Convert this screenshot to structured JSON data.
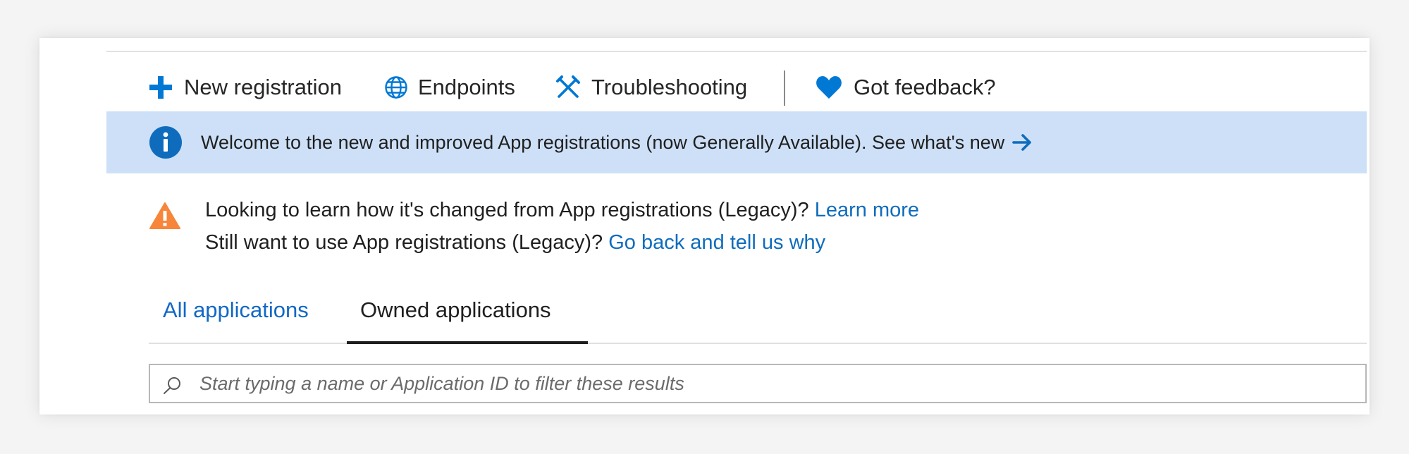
{
  "colors": {
    "accent": "#0078d4",
    "link": "#0f6cbd",
    "info_banner_bg": "#cde0f7",
    "warning": "#f7863a",
    "heart": "#0078d4"
  },
  "toolbar": {
    "items": [
      {
        "label": "New registration",
        "icon": "plus-icon"
      },
      {
        "label": "Endpoints",
        "icon": "globe-icon"
      },
      {
        "label": "Troubleshooting",
        "icon": "tools-icon"
      },
      {
        "label": "Got feedback?",
        "icon": "heart-icon"
      }
    ]
  },
  "info_banner": {
    "icon": "info-icon",
    "text": "Welcome to the new and improved App registrations (now Generally Available). See what's new",
    "arrow_icon": "arrow-right-icon"
  },
  "warning": {
    "icon": "warning-icon",
    "line1_text": "Looking to learn how it's changed from App registrations (Legacy)? ",
    "line1_link": "Learn more",
    "line2_text": "Still want to use App registrations (Legacy)? ",
    "line2_link": "Go back and tell us why"
  },
  "tabs": {
    "items": [
      {
        "label": "All applications",
        "selected": false
      },
      {
        "label": "Owned applications",
        "selected": true
      }
    ]
  },
  "search": {
    "icon": "search-icon",
    "placeholder": "Start typing a name or Application ID to filter these results",
    "value": ""
  }
}
